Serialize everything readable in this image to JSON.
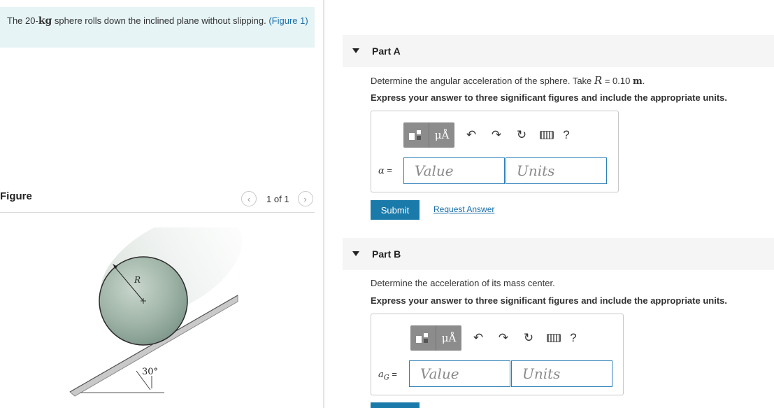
{
  "problem": {
    "text_before": "The 20-",
    "kg": "kg",
    "text_after": " sphere rolls down the inclined plane without slipping. ",
    "figure_link": "(Figure 1)"
  },
  "figure": {
    "label": "Figure",
    "pager_text": "1 of 1",
    "prev_icon": "chevron-left-icon",
    "next_icon": "chevron-right-icon",
    "radius_label": "R",
    "angle_label": "30°"
  },
  "partA": {
    "title": "Part A",
    "question_before": "Determine the angular acceleration of the sphere. Take ",
    "question_var": "R",
    "question_eq": " = 0.10 ",
    "question_unit": "m",
    "question_end": ".",
    "instruction": "Express your answer to three significant figures and include the appropriate units.",
    "answer_label": "α",
    "answer_eq": " =",
    "value_placeholder": "Value",
    "units_placeholder": "Units",
    "submit_label": "Submit",
    "request_label": "Request Answer"
  },
  "partB": {
    "title": "Part B",
    "question": "Determine the acceleration of its mass center.",
    "instruction": "Express your answer to three significant figures and include the appropriate units.",
    "answer_label": "a",
    "answer_sub": "G",
    "answer_eq": " =",
    "value_placeholder": "Value",
    "units_placeholder": "Units"
  },
  "toolbar": {
    "mu_label": "μÅ",
    "help_label": "?",
    "undo_icon": "undo-icon",
    "redo_icon": "redo-icon",
    "reset_icon": "reset-icon",
    "keyboard_icon": "keyboard-icon"
  }
}
